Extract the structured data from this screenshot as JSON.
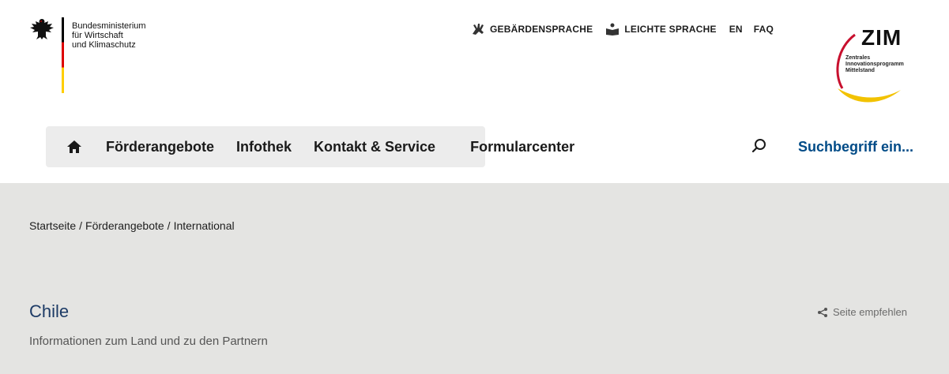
{
  "ministry": {
    "line1": "Bundesministerium",
    "line2": "für Wirtschaft",
    "line3": "und Klimaschutz"
  },
  "service_links": {
    "sign_language": "GEBÄRDENSPRACHE",
    "easy_language": "LEICHTE SPRACHE",
    "english": "EN",
    "faq": "FAQ"
  },
  "zim": {
    "title": "ZIM",
    "line1": "Zentrales",
    "line2": "Innovationsprogramm",
    "line3": "Mittelstand"
  },
  "nav": {
    "items": [
      "Förderangebote",
      "Infothek",
      "Kontakt & Service",
      "Formularcenter"
    ],
    "search_placeholder": "Suchbegriff ein..."
  },
  "breadcrumb": [
    "Startseite",
    "Förderangebote",
    "International"
  ],
  "page": {
    "title": "Chile",
    "subtitle": "Informationen zum Land und zu den Partnern",
    "share_label": "Seite empfehlen"
  },
  "colors": {
    "accent": "#004b87",
    "title": "#1d3b66",
    "content_bg": "#e4e4e2"
  }
}
